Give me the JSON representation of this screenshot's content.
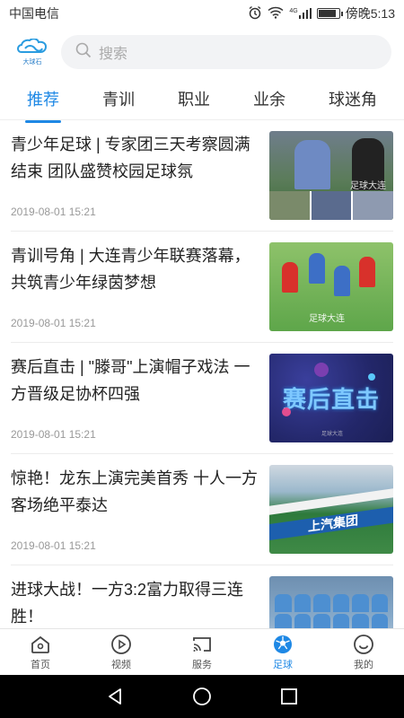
{
  "status_bar": {
    "carrier": "中国电信",
    "network": "4G",
    "time": "傍晚5:13",
    "battery_level": 0.8
  },
  "header": {
    "logo_text": "大球石",
    "search": {
      "placeholder": "搜索",
      "icon": "search-icon"
    }
  },
  "tabs": [
    {
      "label": "推荐",
      "active": true
    },
    {
      "label": "青训",
      "active": false
    },
    {
      "label": "职业",
      "active": false
    },
    {
      "label": "业余",
      "active": false
    },
    {
      "label": "球迷角",
      "active": false
    }
  ],
  "articles": [
    {
      "title": "青少年足球 | 专家团三天考察圆满结束 团队盛赞校园足球氛",
      "date": "2019-08-01 15:21",
      "thumb_watermark": "足球大连"
    },
    {
      "title": "青训号角 | 大连青少年联赛落幕，共筑青少年绿茵梦想",
      "date": "2019-08-01 15:21",
      "thumb_watermark": "足球大连"
    },
    {
      "title": "赛后直击 | \"滕哥\"上演帽子戏法 一方晋级足协杯四强",
      "date": "2019-08-01 15:21",
      "thumb_text": "赛后直击",
      "thumb_small": "足球大连"
    },
    {
      "title": "惊艳！龙东上演完美首秀 十人一方客场绝平泰达",
      "date": "2019-08-01 15:21",
      "thumb_banner": "上汽集团"
    },
    {
      "title": "进球大战！一方3:2富力取得三连胜！",
      "date": "",
      "thumb_banner": ""
    }
  ],
  "bottom_nav": [
    {
      "label": "首页",
      "icon": "home-icon",
      "active": false
    },
    {
      "label": "视频",
      "icon": "play-icon",
      "active": false
    },
    {
      "label": "服务",
      "icon": "cast-icon",
      "active": false
    },
    {
      "label": "足球",
      "icon": "football-icon",
      "active": true
    },
    {
      "label": "我的",
      "icon": "smile-icon",
      "active": false
    }
  ],
  "colors": {
    "accent": "#1e88e5",
    "text": "#222222",
    "muted": "#999999"
  }
}
